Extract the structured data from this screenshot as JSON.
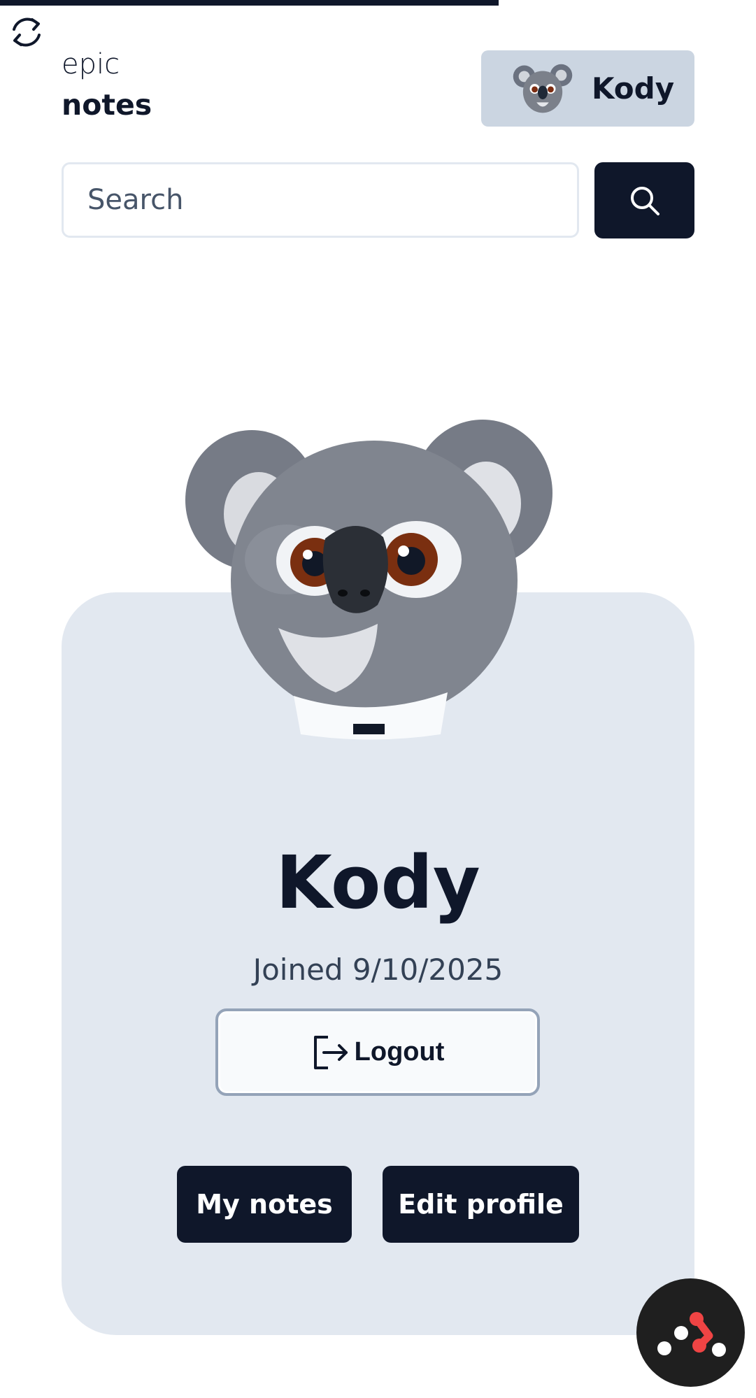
{
  "header": {
    "logo_line1": "epic",
    "logo_line2": "notes",
    "user_name": "Kody"
  },
  "search": {
    "placeholder": "Search"
  },
  "profile": {
    "name": "Kody",
    "joined": "Joined 9/10/2025",
    "logout_label": "Logout",
    "my_notes_label": "My notes",
    "edit_profile_label": "Edit profile"
  },
  "progress": 0.66,
  "colors": {
    "primary": "#0f172a",
    "card_bg": "#e2e8f0",
    "user_button_bg": "#cbd5e1",
    "accent_red": "#ef4444"
  },
  "icons": {
    "refresh": "refresh-icon",
    "search": "search-icon",
    "logout": "logout-icon",
    "fab": "devtools-icon"
  }
}
